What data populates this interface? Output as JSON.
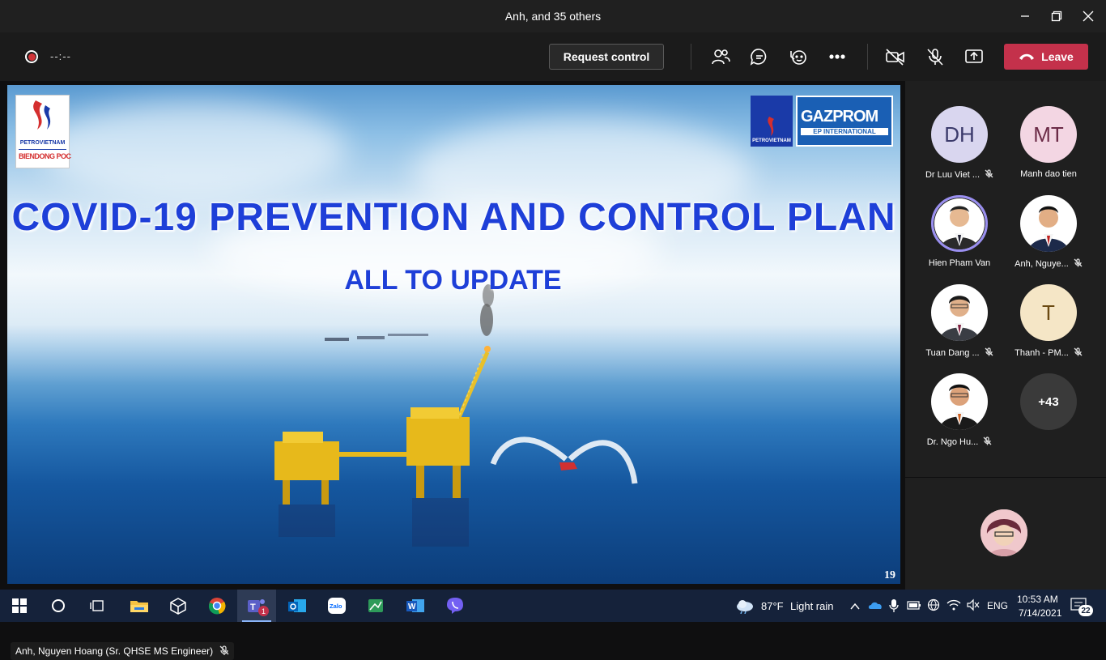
{
  "window": {
    "title": "Anh, and 35 others"
  },
  "meeting_bar": {
    "timer": "--:--",
    "request_control_label": "Request control",
    "leave_label": "Leave"
  },
  "slide": {
    "title": "COVID-19 PREVENTION AND CONTROL PLAN",
    "subtitle": "ALL TO UPDATE",
    "page_number": "19",
    "logo_left_top": "PETROVIETNAM",
    "logo_left_bottom": "BIENDONG POC",
    "logo_right_a": "PETROVIETNAM",
    "logo_right_b": "GAZPROM",
    "logo_right_c": "EP INTERNATIONAL"
  },
  "presenter": {
    "name": "Anh, Nguyen Hoang (Sr. QHSE MS Engineer)"
  },
  "participants": [
    {
      "initials": "DH",
      "name": "Dr Luu Viet ...",
      "muted": true,
      "bg": "#d9d6ef",
      "fg": "#3b3a6b"
    },
    {
      "initials": "MT",
      "name": "Manh dao tien",
      "muted": false,
      "bg": "#f3d6e3",
      "fg": "#6b2b47"
    },
    {
      "initials": "",
      "name": "Hien Pham Van",
      "muted": false,
      "speaking": true
    },
    {
      "initials": "",
      "name": "Anh, Nguye...",
      "muted": true
    },
    {
      "initials": "",
      "name": "Tuan Dang ...",
      "muted": true
    },
    {
      "initials": "T",
      "name": "Thanh - PM...",
      "muted": true,
      "bg": "#f5e6c6",
      "fg": "#6b4a12"
    },
    {
      "initials": "",
      "name": "Dr. Ngo Hu...",
      "muted": true
    },
    {
      "initials": "+43",
      "name": "",
      "muted": false,
      "bg": "#3a3a3a",
      "fg": "#ffffff"
    }
  ],
  "taskbar": {
    "weather_temp": "87°F",
    "weather_desc": "Light rain",
    "language": "ENG",
    "time": "10:53 AM",
    "date": "7/14/2021",
    "notification_count": "22",
    "teams_badge": "1"
  },
  "colors": {
    "leave": "#c4314b",
    "title_text": "#1e3fd8",
    "taskbar": "#15223a"
  }
}
